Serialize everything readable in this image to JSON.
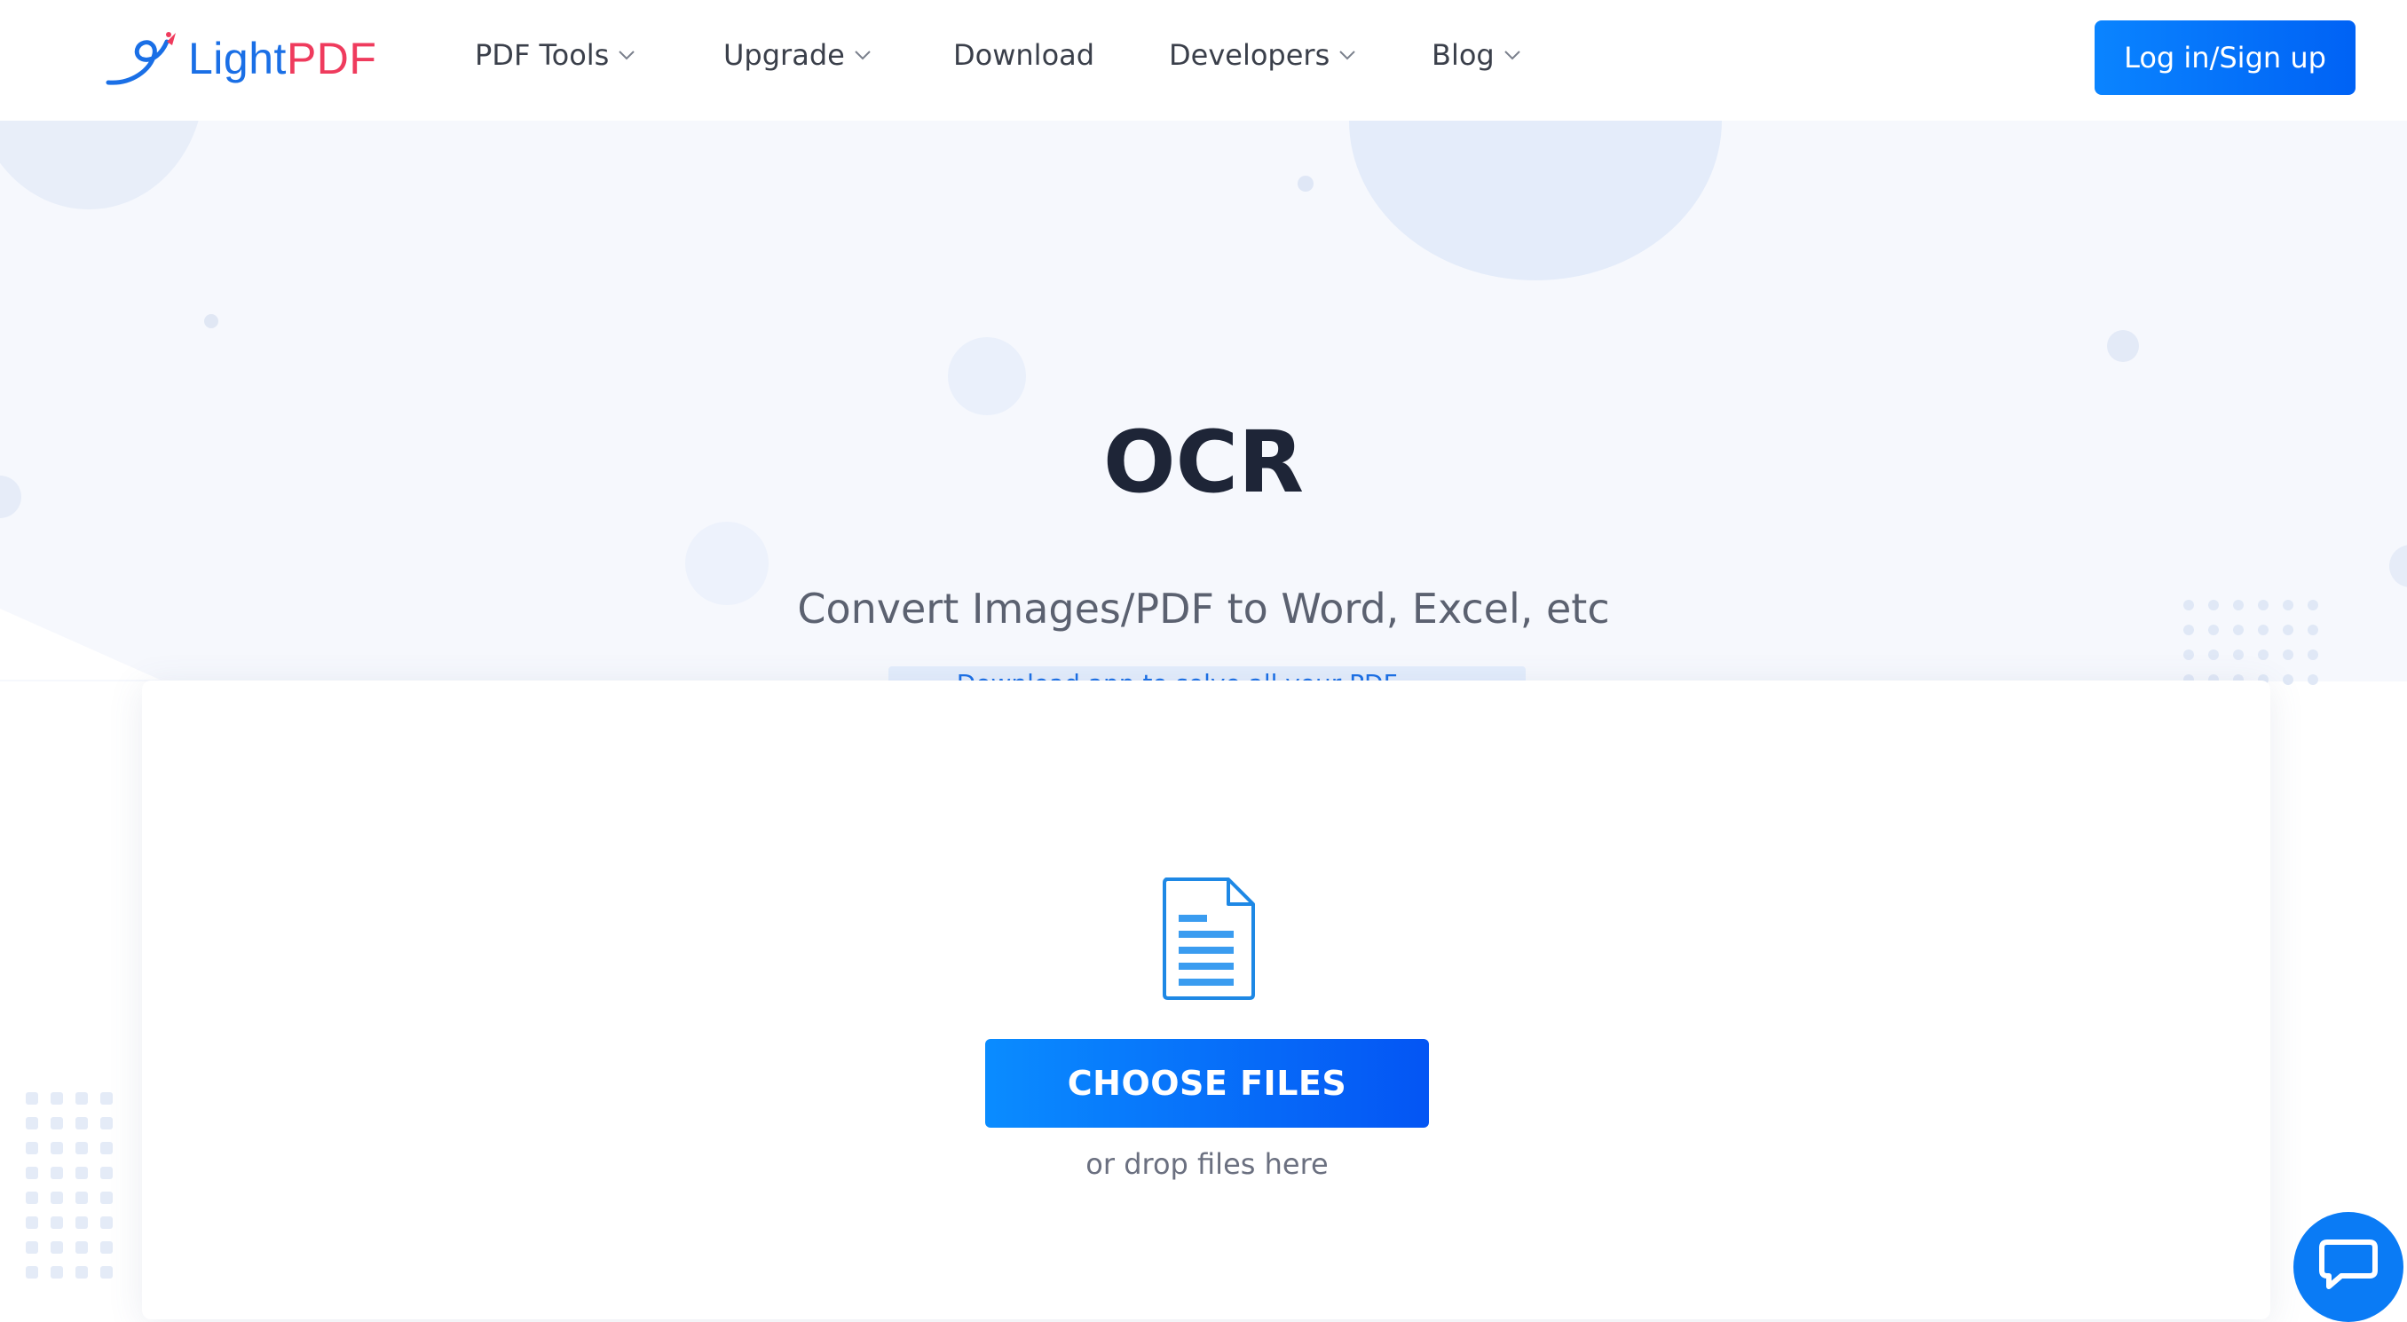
{
  "brand": {
    "name_part1": "Light",
    "name_part2": "PDF",
    "logo_icon": "bird-logo-icon",
    "colors": {
      "primary": "#1a6fe6",
      "accent": "#ef3b5d"
    }
  },
  "nav": {
    "items": [
      {
        "label": "PDF Tools",
        "has_dropdown": true
      },
      {
        "label": "Upgrade",
        "has_dropdown": true
      },
      {
        "label": "Download",
        "has_dropdown": false
      },
      {
        "label": "Developers",
        "has_dropdown": true
      },
      {
        "label": "Blog",
        "has_dropdown": true
      }
    ],
    "login_label": "Log in/Sign up"
  },
  "hero": {
    "title": "OCR",
    "subtitle": "Convert Images/PDF to Word, Excel, etc",
    "promo_label": "Download app to solve all your PDF problems"
  },
  "upload": {
    "file_icon": "document-icon",
    "choose_label": "CHOOSE FILES",
    "drop_hint": "or drop files here"
  },
  "chat": {
    "icon": "chat-bubble-icon",
    "color": "#0a7bf5"
  }
}
